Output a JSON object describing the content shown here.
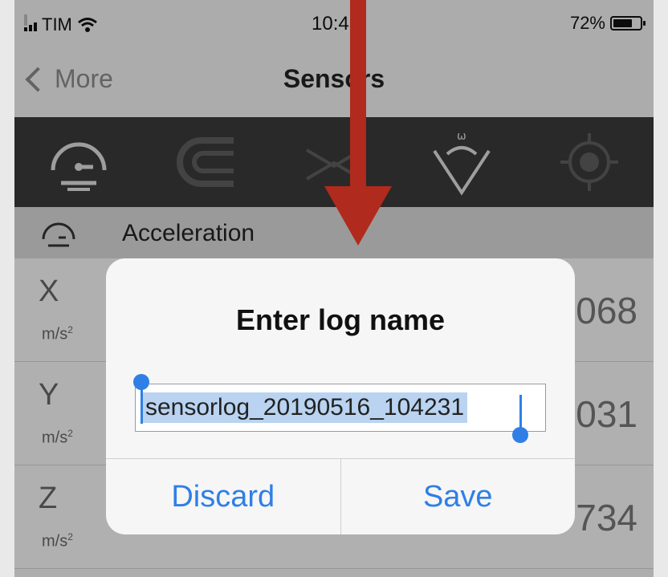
{
  "status_bar": {
    "carrier": "TIM",
    "time": "10:43",
    "battery": "72%",
    "battery_level": 0.72
  },
  "nav": {
    "back_label": "More",
    "title": "Sensors"
  },
  "toolbar": {
    "icons": [
      "speedometer-icon",
      "magnet-icon",
      "gyroscope-icon",
      "angular-velocity-icon",
      "location-target-icon"
    ]
  },
  "section": {
    "label": "Acceleration"
  },
  "rows": [
    {
      "axis": "X",
      "unit": "m/s",
      "unit_exp": "2",
      "value_visible": "068"
    },
    {
      "axis": "Y",
      "unit": "m/s",
      "unit_exp": "2",
      "value_visible": "031"
    },
    {
      "axis": "Z",
      "unit": "m/s",
      "unit_exp": "2",
      "value_visible": "734"
    }
  ],
  "dialog": {
    "title": "Enter log name",
    "input_value": "sensorlog_20190516_104231",
    "discard_label": "Discard",
    "save_label": "Save"
  },
  "colors": {
    "accent": "#2f7fe6",
    "annotation_arrow": "#b02a1e",
    "toolbar_bg": "#3a3a3a"
  }
}
